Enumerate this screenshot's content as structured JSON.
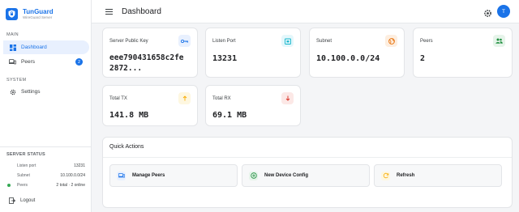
{
  "brand": {
    "title": "TunGuard",
    "subtitle": "WireGuard Server"
  },
  "sidebar": {
    "main_label": "MAIN",
    "system_label": "SYSTEM",
    "items": [
      {
        "label": "Dashboard",
        "icon": "dashboard-icon"
      },
      {
        "label": "Peers",
        "icon": "peers-icon",
        "badge": "2"
      },
      {
        "label": "Settings",
        "icon": "gear-icon"
      }
    ],
    "status": {
      "title": "SERVER STATUS",
      "rows": [
        {
          "label": "Listen port",
          "value": "13231"
        },
        {
          "label": "Subnet",
          "value": "10.100.0.0/24"
        },
        {
          "label": "Peers",
          "value": "2 total · 2 online"
        }
      ]
    },
    "logout": "Logout"
  },
  "topbar": {
    "title": "Dashboard",
    "avatar": "T"
  },
  "stats": [
    {
      "label": "Server Public Key",
      "value": "eee790431658c2fe\n2872...",
      "icon": "key-icon",
      "color": "#1a73e8",
      "bg": "#e8f0fe"
    },
    {
      "label": "Listen Port",
      "value": "13231",
      "icon": "port-icon",
      "color": "#12b5cb",
      "bg": "#e4f7fb"
    },
    {
      "label": "Subnet",
      "value": "10.100.0.0/24",
      "icon": "globe-icon",
      "color": "#e8710a",
      "bg": "#fdeee0"
    },
    {
      "label": "Peers",
      "value": "2",
      "icon": "people-icon",
      "color": "#1e8e3e",
      "bg": "#e6f4ea"
    },
    {
      "label": "Total TX",
      "value": "141.8 MB",
      "icon": "upload-icon",
      "color": "#f9ab00",
      "bg": "#fef7e0"
    },
    {
      "label": "Total RX",
      "value": "69.1 MB",
      "icon": "download-icon",
      "color": "#d93025",
      "bg": "#fce8e6"
    }
  ],
  "quick_actions": {
    "title": "Quick Actions",
    "buttons": [
      {
        "label": "Manage Peers",
        "icon": "devices-icon",
        "color": "#1a73e8",
        "bg": "#e8f0fe"
      },
      {
        "label": "New Device Config",
        "icon": "add-circle-icon",
        "color": "#1e8e3e",
        "bg": "#e6f4ea"
      },
      {
        "label": "Refresh",
        "icon": "refresh-icon",
        "color": "#f9ab00",
        "bg": "#fef7e0"
      }
    ]
  }
}
